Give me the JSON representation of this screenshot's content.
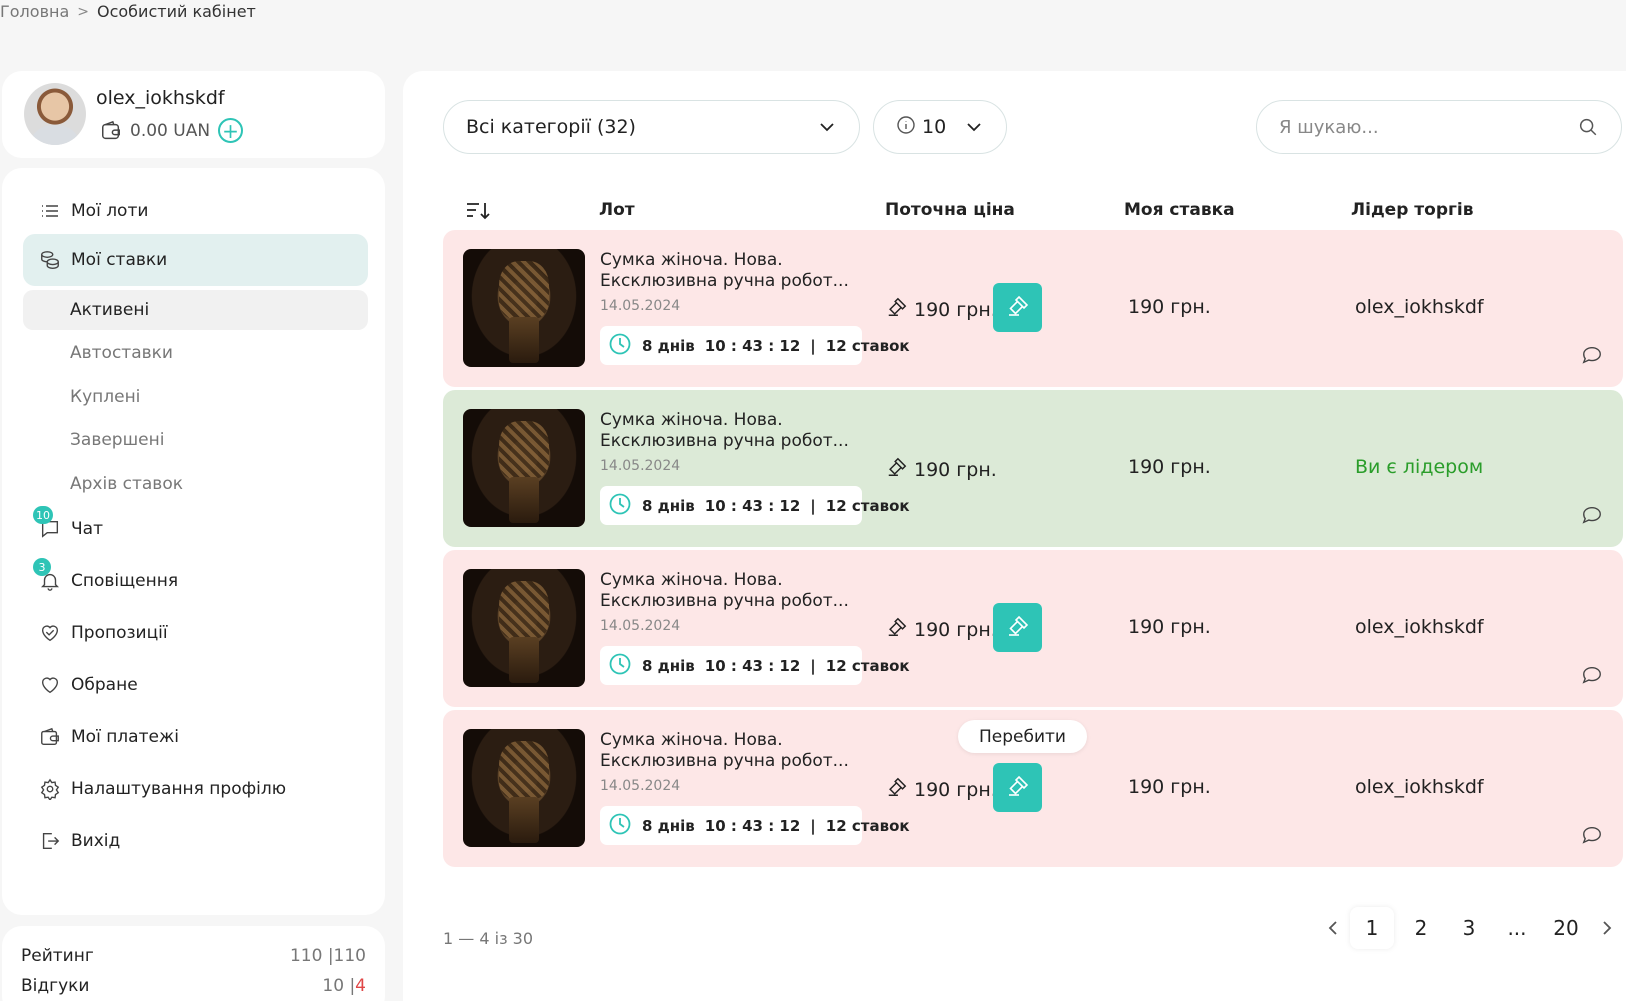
{
  "breadcrumb": {
    "home": "Головна",
    "current": "Особистий кабінет"
  },
  "profile": {
    "username": "olex_iokhskdf",
    "balance": "0.00 UAN"
  },
  "menu": {
    "my_lots": "Мої лоти",
    "my_bids": "Мої ставки",
    "sub": {
      "active": "Активені",
      "autobids": "Автоставки",
      "bought": "Куплені",
      "finished": "Завершені",
      "archive": "Архів ставок"
    },
    "chat": "Чат",
    "chat_badge": "10",
    "notifications": "Сповіщення",
    "notifications_badge": "3",
    "offers": "Пропозиції",
    "favorites": "Обране",
    "payments": "Мої платежі",
    "settings": "Налаштування профілю",
    "logout": "Вихід"
  },
  "rating": {
    "label": "Рейтинг",
    "value": "110 |110",
    "reviews_label": "Відгуки",
    "reviews_pos": "10 |",
    "reviews_neg": "4"
  },
  "filters": {
    "category": "Всі категорії (32)",
    "per_page": "10",
    "search_placeholder": "Я шукаю..."
  },
  "table": {
    "col_lot": "Лот",
    "col_price": "Поточна ціна",
    "col_mybid": "Моя ставка",
    "col_leader": "Лідер торгів"
  },
  "lots": [
    {
      "title": "Сумка жіноча. Нова. Ексклюзивна ручна робот...",
      "date": "14.05.2024",
      "days": "8 днів",
      "time": "10 : 43 : 12",
      "bids": "12 ставок",
      "price": "190 грн.",
      "my_bid": "190 грн.",
      "leader": "olex_iokhskdf",
      "status": "outbid"
    },
    {
      "title": "Сумка жіноча. Нова. Ексклюзивна ручна робот...",
      "date": "14.05.2024",
      "days": "8 днів",
      "time": "10 : 43 : 12",
      "bids": "12 ставок",
      "price": "190 грн.",
      "my_bid": "190 грн.",
      "leader": "Ви є лідером",
      "status": "leading"
    },
    {
      "title": "Сумка жіноча. Нова. Ексклюзивна ручна робот...",
      "date": "14.05.2024",
      "days": "8 днів",
      "time": "10 : 43 : 12",
      "bids": "12 ставок",
      "price": "190 грн.",
      "my_bid": "190 грн.",
      "leader": "olex_iokhskdf",
      "status": "outbid"
    },
    {
      "title": "Сумка жіноча. Нова. Ексклюзивна ручна робот...",
      "date": "14.05.2024",
      "days": "8 днів",
      "time": "10 : 43 : 12",
      "bids": "12 ставок",
      "price": "190 грн.",
      "my_bid": "190 грн.",
      "leader": "olex_iokhskdf",
      "status": "outbid"
    }
  ],
  "tooltip": "Перебити",
  "pagination": {
    "range": "1 — 4 із 30",
    "pages": [
      "1",
      "2",
      "3",
      "...",
      "20"
    ],
    "current": "1"
  },
  "colors": {
    "accent": "#2ec4b6",
    "outbid_row": "#fde7e7",
    "leading_row": "#dcead7",
    "leader_text": "#2a9d2a"
  },
  "icons": [
    "wallet-icon",
    "plus-icon",
    "list-icon",
    "coins-icon",
    "chat-icon",
    "bell-icon",
    "handshake-icon",
    "heart-icon",
    "payment-icon",
    "gear-icon",
    "logout-icon",
    "chevron-down-icon",
    "info-icon",
    "search-icon",
    "sort-icon",
    "clock-icon",
    "gavel-icon",
    "comment-icon",
    "chevron-left-icon",
    "chevron-right-icon"
  ]
}
